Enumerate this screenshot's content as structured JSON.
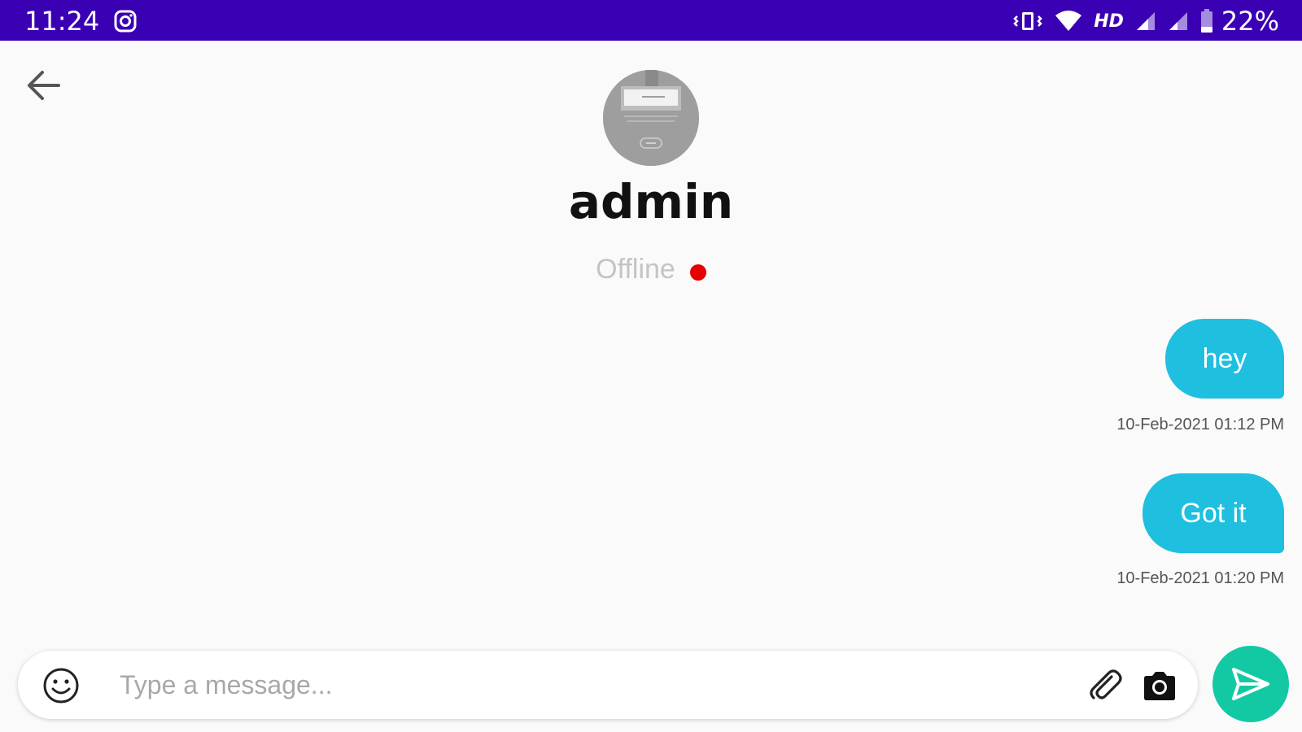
{
  "status_bar": {
    "time": "11:24",
    "network_label": "HD",
    "battery": "22%",
    "background_color": "#3a00b4",
    "icons": [
      "instagram-icon",
      "vibrate-icon",
      "wifi-icon",
      "signal-icon",
      "battery-icon"
    ]
  },
  "header": {
    "back_icon": "arrow-left-icon",
    "contact_name": "admin",
    "presence": "Offline",
    "presence_color": "#e60000"
  },
  "messages": [
    {
      "text": "hey",
      "timestamp": "10-Feb-2021 01:12 PM",
      "direction": "outgoing"
    },
    {
      "text": "Got it",
      "timestamp": "10-Feb-2021 01:20 PM",
      "direction": "outgoing"
    }
  ],
  "composer": {
    "placeholder": "Type a message...",
    "value": "",
    "icons": [
      "emoji-icon",
      "paperclip-icon",
      "camera-icon",
      "send-icon"
    ],
    "send_color": "#13c9a3"
  },
  "colors": {
    "bubble": "#1fbfe0",
    "background": "#fafafa"
  }
}
